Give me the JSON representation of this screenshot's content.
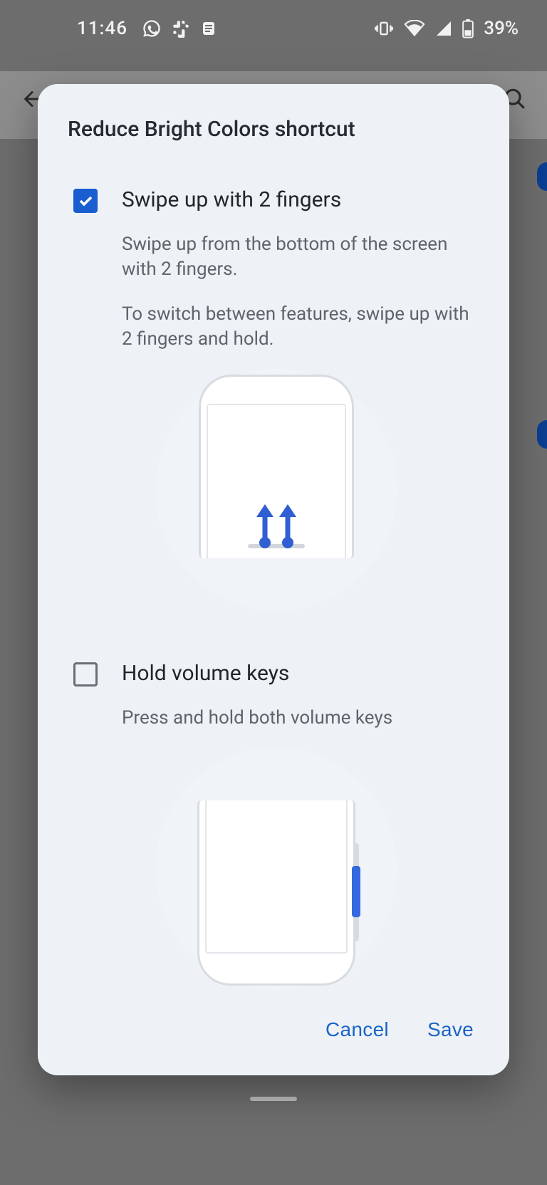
{
  "status": {
    "time": "11:46",
    "battery_text": "39%"
  },
  "dialog": {
    "title": "Reduce Bright Colors shortcut",
    "options": [
      {
        "title": "Swipe up with 2 fingers",
        "desc1": "Swipe up from the bottom of the screen with 2 fingers.",
        "desc2": "To switch between features, swipe up with 2 fingers and hold."
      },
      {
        "title": "Hold volume keys",
        "desc1": "Press and hold both volume keys"
      }
    ],
    "actions": {
      "cancel": "Cancel",
      "save": "Save"
    }
  }
}
